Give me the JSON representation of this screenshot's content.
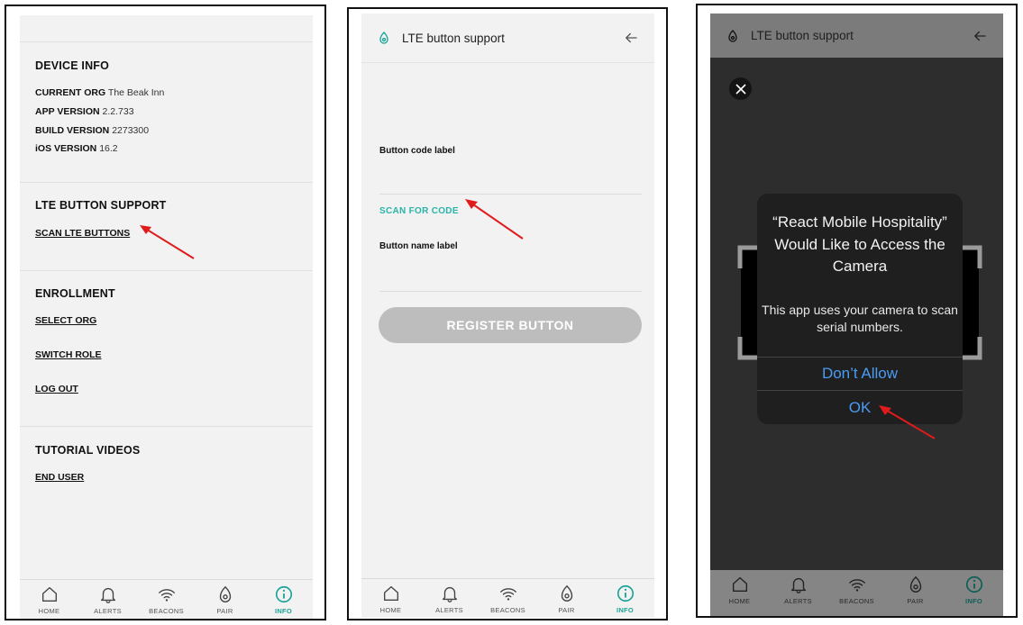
{
  "panel1": {
    "device_info": {
      "title": "DEVICE INFO",
      "rows": [
        {
          "label": "CURRENT ORG",
          "value": "The Beak Inn"
        },
        {
          "label": "APP VERSION",
          "value": "2.2.733"
        },
        {
          "label": "BUILD VERSION",
          "value": "2273300"
        },
        {
          "label": "iOS VERSION",
          "value": "16.2"
        }
      ]
    },
    "lte": {
      "title": "LTE BUTTON SUPPORT",
      "scan_link": "SCAN LTE BUTTONS"
    },
    "enrollment": {
      "title": "ENROLLMENT",
      "select_org": "SELECT ORG",
      "switch_role": "SWITCH ROLE",
      "log_out": "LOG OUT"
    },
    "tutorial": {
      "title": "TUTORIAL VIDEOS",
      "end_user": "END USER"
    }
  },
  "panel2": {
    "header_title": "LTE button support",
    "button_code_label": "Button code label",
    "scan_for_code": "SCAN FOR CODE",
    "button_name_label": "Button name label",
    "register_button": "REGISTER BUTTON"
  },
  "panel3": {
    "header_title": "LTE button support",
    "dialog": {
      "title": "“React Mobile Hospitality” Would Like to Access the Camera",
      "message": "This app uses your camera to scan serial numbers.",
      "dont_allow": "Don’t Allow",
      "ok": "OK"
    }
  },
  "tabs": [
    {
      "label": "HOME",
      "icon": "home-icon"
    },
    {
      "label": "ALERTS",
      "icon": "bell-icon"
    },
    {
      "label": "BEACONS",
      "icon": "wifi-icon"
    },
    {
      "label": "PAIR",
      "icon": "pair-icon"
    },
    {
      "label": "INFO",
      "icon": "info-icon"
    }
  ],
  "colors": {
    "accent": "#1aa398",
    "link_teal": "#2bb3a8",
    "ios_blue": "#4b9bf5",
    "annotation_arrow": "#e01b1b",
    "button_disabled": "#bdbdbd"
  }
}
